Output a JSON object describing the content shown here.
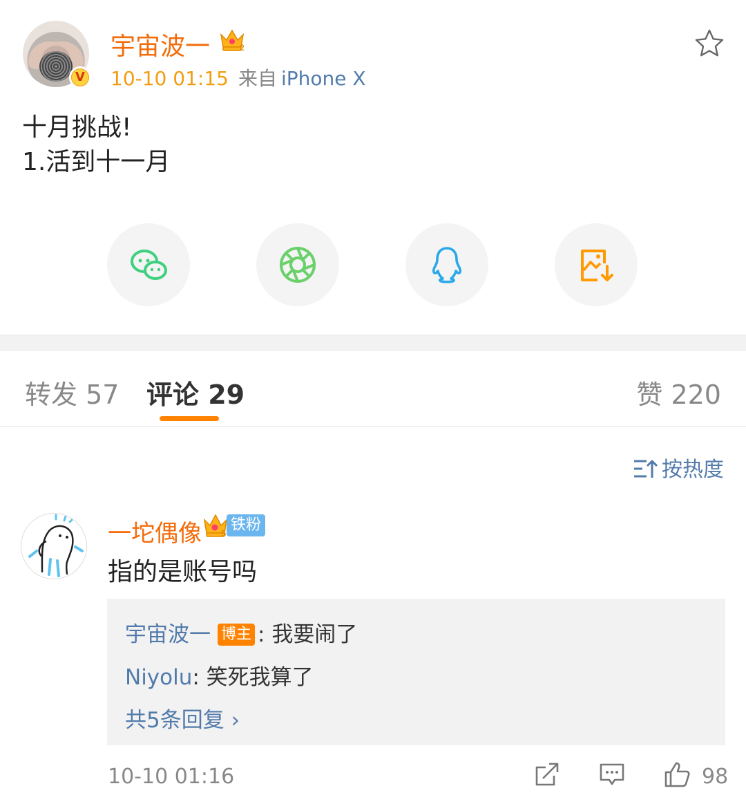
{
  "post": {
    "author": "宇宙波一",
    "time": "10-10 01:15",
    "from_label": "来自",
    "device": "iPhone X",
    "lines": [
      "十月挑战!",
      "1.活到十一月"
    ]
  },
  "share": [
    {
      "name": "wechat-icon",
      "color": "#3fcf7f"
    },
    {
      "name": "moments-icon",
      "color": "#6ad06a"
    },
    {
      "name": "qq-icon",
      "color": "#2aa8ea"
    },
    {
      "name": "save-image-icon",
      "color": "#ff9a00"
    }
  ],
  "tabs": {
    "repost": "转发 57",
    "comment": "评论 29",
    "like": "赞 220"
  },
  "sort_label": "按热度",
  "comment": {
    "name": "一坨偶像",
    "fan_badge": "铁粉",
    "text": "指的是账号吗",
    "replies": [
      {
        "name": "宇宙波一",
        "tag": "博主",
        "text": ": 我要闹了"
      },
      {
        "name": "Niyolu",
        "text": ": 笑死我算了"
      }
    ],
    "more_replies": "共5条回复 ›",
    "time": "10-10 01:16",
    "likes": "98"
  },
  "colors": {
    "accent": "#ff8200",
    "name": "#f36c0b",
    "link": "#527bab"
  }
}
